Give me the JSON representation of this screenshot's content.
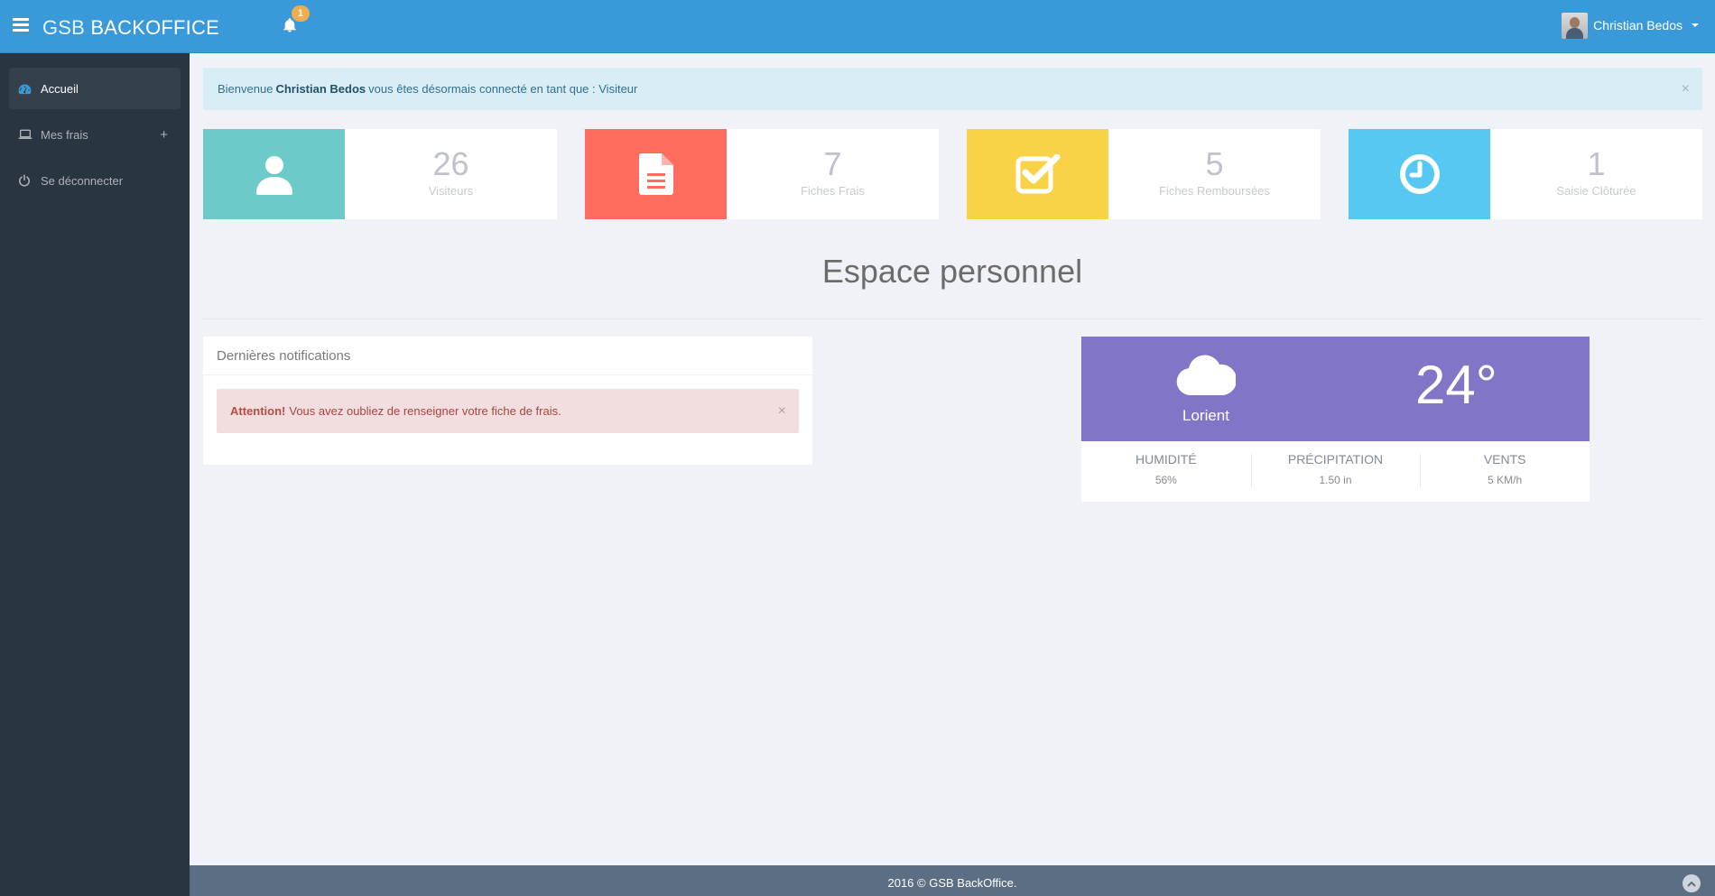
{
  "header": {
    "logo_part1": "GSB",
    "logo_part2": "BACKOFFICE",
    "notification_count": "1",
    "user_name": "Christian Bedos",
    "accent_color": "#3a9ad9"
  },
  "sidebar": {
    "items": [
      {
        "label": "Accueil",
        "icon": "dashboard-icon",
        "active": true
      },
      {
        "label": "Mes frais",
        "icon": "laptop-icon",
        "expand": "+"
      },
      {
        "label": "Se déconnecter",
        "icon": "power-icon"
      }
    ]
  },
  "welcome": {
    "prefix": "Bienvenue",
    "name": "Christian Bedos",
    "suffix": "vous êtes désormais connecté en tant que : Visiteur",
    "close": "×"
  },
  "stats": [
    {
      "value": "26",
      "label": "Visiteurs",
      "icon": "user-icon",
      "color": "#6ccac9"
    },
    {
      "value": "7",
      "label": "Fiches Frais",
      "icon": "file-text-icon",
      "color": "#ff6c60"
    },
    {
      "value": "5",
      "label": "Fiches Remboursées",
      "icon": "check-square-icon",
      "color": "#f8d347"
    },
    {
      "value": "1",
      "label": "Saisie Clôturée",
      "icon": "clock-icon",
      "color": "#57c8f2"
    }
  ],
  "page_title": "Espace personnel",
  "notifications": {
    "title": "Dernières notifications",
    "alert_strong": "Attention!",
    "alert_text": "Vous avez oubliez de renseigner votre fiche de frais.",
    "close": "×"
  },
  "weather": {
    "city": "Lorient",
    "temperature": "24°",
    "icon": "cloud-icon",
    "color": "#8175c7",
    "stats": [
      {
        "label": "HUMIDITÉ",
        "value": "56%"
      },
      {
        "label": "PRÉCIPITATION",
        "value": "1.50 in"
      },
      {
        "label": "VENTS",
        "value": "5 KM/h"
      }
    ]
  },
  "footer": {
    "text": "2016 © GSB BackOffice."
  }
}
